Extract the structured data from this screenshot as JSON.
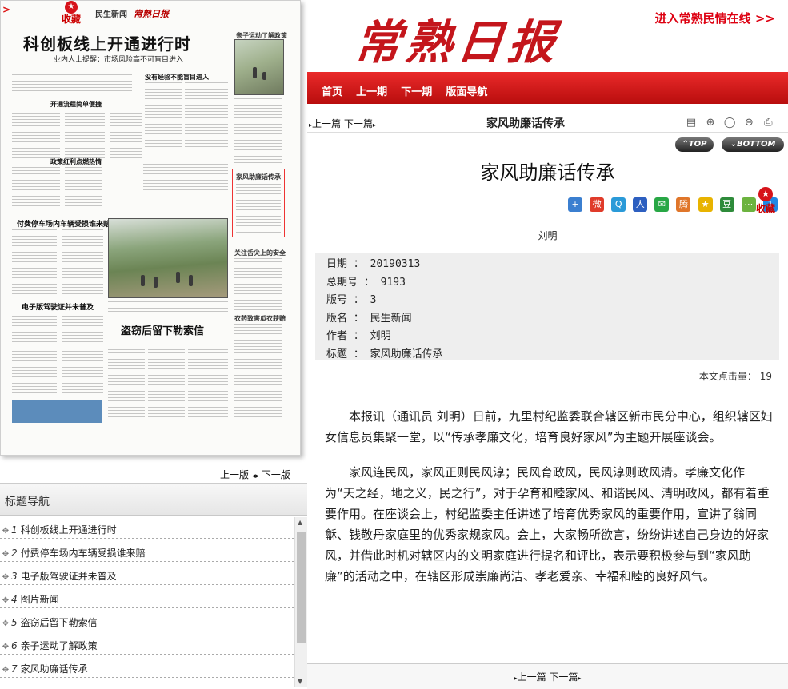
{
  "paper": {
    "favorite_label": "收藏",
    "masthead": "民生新闻",
    "masthead_logo": "常熟日报",
    "headline": "科创板线上开通进行时",
    "subheadline": "业内人士提醒：市场风险高不可盲目进入",
    "sections": {
      "a": "开通流程简单便捷",
      "b": "没有经验不能盲目进入",
      "c": "政策红利点燃热情",
      "d": "付费停车场内车辆受损谁来赔",
      "e": "电子版驾驶证并未普及",
      "f": "盗窃后留下勒索信",
      "g": "亲子运动了解政策",
      "h": "家风助廉话传承",
      "i": "关注舌尖上的安全",
      "j": "农药致害瓜农获赔"
    },
    "prev_page": "上一版",
    "next_page": "下一版"
  },
  "title_nav": {
    "heading": "标题导航",
    "items": [
      {
        "num": "1",
        "label": "科创板线上开通进行时"
      },
      {
        "num": "2",
        "label": "付费停车场内车辆受损谁来赔"
      },
      {
        "num": "3",
        "label": "电子版驾驶证并未普及"
      },
      {
        "num": "4",
        "label": "图片新闻"
      },
      {
        "num": "5",
        "label": "盗窃后留下勒索信"
      },
      {
        "num": "6",
        "label": "亲子运动了解政策"
      },
      {
        "num": "7",
        "label": "家风助廉话传承"
      }
    ]
  },
  "site": {
    "logo": "常熟日报",
    "enter_link": "进入常熟民情在线 >>",
    "nav": [
      "首页",
      "上一期",
      "下一期",
      "版面导航"
    ]
  },
  "article": {
    "bar_prev": "上一篇",
    "bar_next": "下一篇",
    "bar_title": "家风助廉话传承",
    "top_label": "TOP",
    "bottom_label": "BOTTOM",
    "title": "家风助廉话传承",
    "favorite_label": "收藏",
    "author": "刘明",
    "meta": {
      "date": "日期 ： 20190313",
      "issue": "总期号 ： 9193",
      "page": "版号 ： 3",
      "page_name": "版名 ： 民生新闻",
      "author": "作者 ： 刘明",
      "title": "标题 ： 家风助廉话传承"
    },
    "hits": "本文点击量： 19",
    "paragraphs": [
      "本报讯（通讯员 刘明）日前，九里村纪监委联合辖区新市民分中心，组织辖区妇女信息员集聚一堂，以“传承孝廉文化，培育良好家风”为主题开展座谈会。",
      "家风连民风，家风正则民风淳；民风育政风，民风淳则政风清。孝廉文化作为“天之经，地之义，民之行”，对于孕育和睦家风、和谐民风、清明政风，都有着重要作用。在座谈会上，村纪监委主任讲述了培育优秀家风的重要作用，宣讲了翁同龢、钱敬丹家庭里的优秀家规家风。会上，大家畅所欲言，纷纷讲述自己身边的好家风，并借此时机对辖区内的文明家庭进行提名和评比，表示要积极参与到“家风助廉”的活动之中，在辖区形成崇廉尚洁、孝老爱亲、幸福和睦的良好风气。"
    ],
    "footer_prev": "上一篇",
    "footer_next": "下一篇"
  },
  "colors": {
    "brand_red": "#c4161c",
    "nav_red": "#d51a1a",
    "meta_bg": "#eeeeee"
  }
}
